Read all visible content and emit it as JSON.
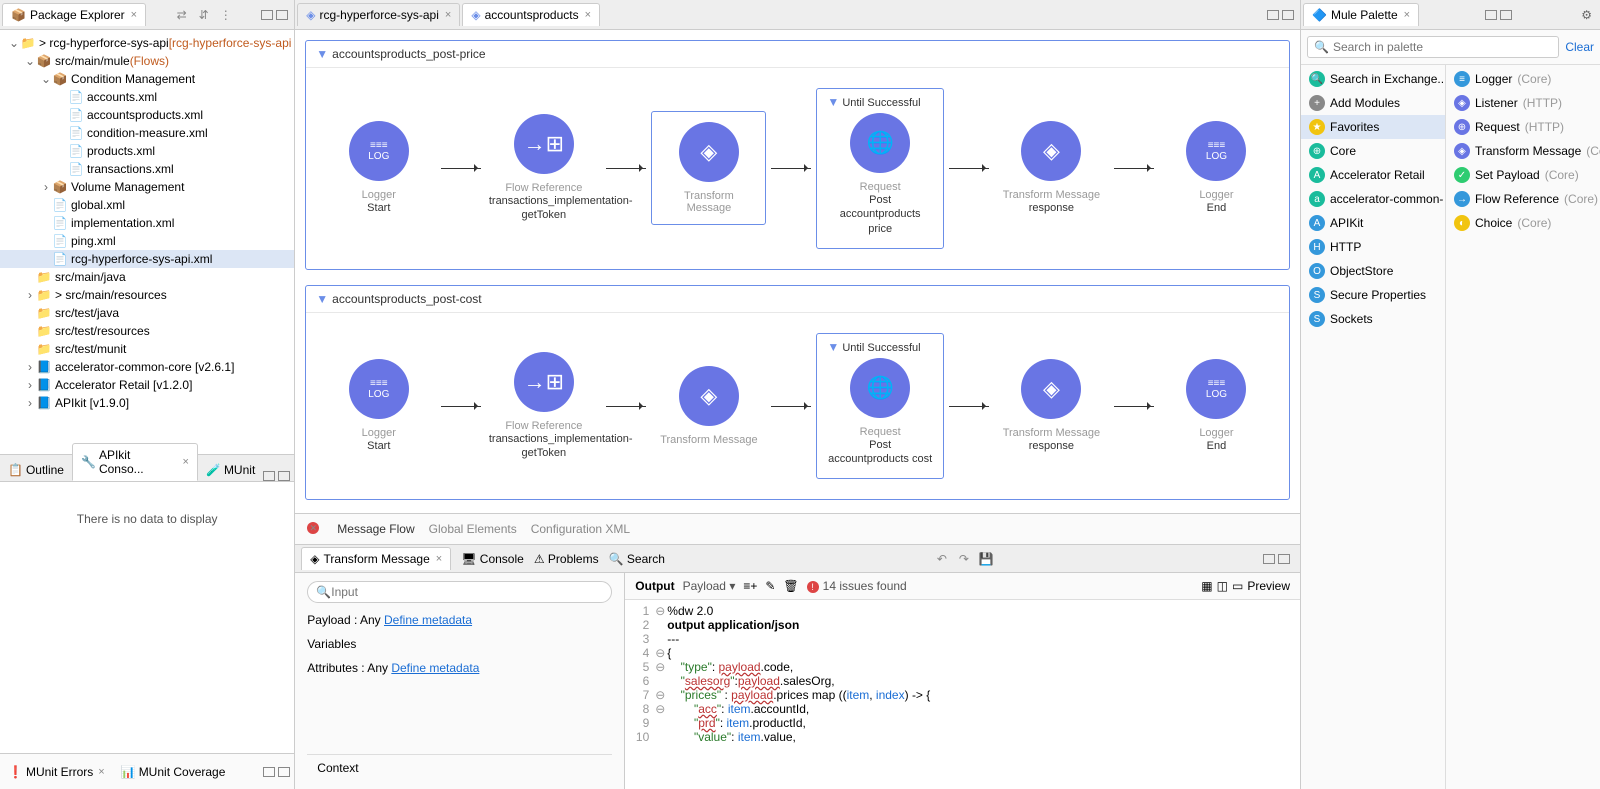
{
  "explorer": {
    "title": "Package Explorer",
    "tree": [
      {
        "depth": 0,
        "twisty": "v",
        "icon": "proj",
        "text": "> rcg-hyperforce-sys-api",
        "suffix": "[rcg-hyperforce-sys-api"
      },
      {
        "depth": 1,
        "twisty": "v",
        "icon": "pkg",
        "text": "src/main/mule",
        "suffix": "(Flows)",
        "sfxColor": "#c05b1f"
      },
      {
        "depth": 2,
        "twisty": "v",
        "icon": "pkg",
        "text": "Condition Management"
      },
      {
        "depth": 3,
        "twisty": "",
        "icon": "xml",
        "text": "accounts.xml"
      },
      {
        "depth": 3,
        "twisty": "",
        "icon": "xml",
        "text": "accountsproducts.xml"
      },
      {
        "depth": 3,
        "twisty": "",
        "icon": "xml",
        "text": "condition-measure.xml"
      },
      {
        "depth": 3,
        "twisty": "",
        "icon": "xml",
        "text": "products.xml"
      },
      {
        "depth": 3,
        "twisty": "",
        "icon": "xml",
        "text": "transactions.xml"
      },
      {
        "depth": 2,
        "twisty": ">",
        "icon": "pkg",
        "text": "Volume Management"
      },
      {
        "depth": 2,
        "twisty": "",
        "icon": "xml",
        "text": "global.xml"
      },
      {
        "depth": 2,
        "twisty": "",
        "icon": "xml",
        "text": "implementation.xml"
      },
      {
        "depth": 2,
        "twisty": "",
        "icon": "xml",
        "text": "ping.xml"
      },
      {
        "depth": 2,
        "twisty": "",
        "icon": "xml",
        "text": "rcg-hyperforce-sys-api.xml",
        "sel": true
      },
      {
        "depth": 1,
        "twisty": "",
        "icon": "folder",
        "text": "src/main/java"
      },
      {
        "depth": 1,
        "twisty": ">",
        "icon": "folder",
        "text": "> src/main/resources"
      },
      {
        "depth": 1,
        "twisty": "",
        "icon": "folder",
        "text": "src/test/java"
      },
      {
        "depth": 1,
        "twisty": "",
        "icon": "folder",
        "text": "src/test/resources"
      },
      {
        "depth": 1,
        "twisty": "",
        "icon": "folder",
        "text": "src/test/munit"
      },
      {
        "depth": 1,
        "twisty": ">",
        "icon": "jar",
        "text": "accelerator-common-core [v2.6.1]"
      },
      {
        "depth": 1,
        "twisty": ">",
        "icon": "jar",
        "text": "Accelerator Retail [v1.2.0]"
      },
      {
        "depth": 1,
        "twisty": ">",
        "icon": "jar",
        "text": "APIkit [v1.9.0]"
      }
    ]
  },
  "lowerLeft": {
    "tabs": [
      "Outline",
      "APIkit Conso...",
      "MUnit"
    ],
    "empty": "There is no data to display",
    "errTabs": [
      "MUnit Errors",
      "MUnit Coverage"
    ]
  },
  "editor": {
    "tabs": [
      {
        "label": "rcg-hyperforce-sys-api",
        "active": false
      },
      {
        "label": "accountsproducts",
        "active": true
      }
    ],
    "flows": [
      {
        "title": "accountsproducts_post-price",
        "until": "Until Successful",
        "req": "Request",
        "reqSub": "Post accountproducts price",
        "nodes": [
          {
            "type": "log",
            "label": "Logger",
            "sub": "Start"
          },
          {
            "type": "ref",
            "label": "Flow Reference",
            "sub": "transactions_implementation-getToken"
          },
          {
            "type": "tm",
            "label": "Transform Message",
            "sub": "",
            "selected": true
          },
          {
            "type": "until"
          },
          {
            "type": "tm",
            "label": "Transform Message",
            "sub": "response"
          },
          {
            "type": "log",
            "label": "Logger",
            "sub": "End"
          }
        ]
      },
      {
        "title": "accountsproducts_post-cost",
        "until": "Until Successful",
        "req": "Request",
        "reqSub": "Post accountproducts cost",
        "nodes": [
          {
            "type": "log",
            "label": "Logger",
            "sub": "Start"
          },
          {
            "type": "ref",
            "label": "Flow Reference",
            "sub": "transactions_implementation-getToken"
          },
          {
            "type": "tm",
            "label": "Transform Message",
            "sub": ""
          },
          {
            "type": "until"
          },
          {
            "type": "tm",
            "label": "Transform Message",
            "sub": "response"
          },
          {
            "type": "log",
            "label": "Logger",
            "sub": "End"
          }
        ]
      }
    ],
    "bottomTabs": [
      "Message Flow",
      "Global Elements",
      "Configuration XML"
    ]
  },
  "tm": {
    "tabs": [
      "Transform Message",
      "Console",
      "Problems",
      "Search"
    ],
    "inputPlaceholder": "Input",
    "payload": "Payload : Any ",
    "defineMeta": "Define metadata",
    "variables": "Variables",
    "attributes": "Attributes : Any ",
    "context": "Context",
    "output": "Output",
    "payloadDD": "Payload",
    "issues": "14 issues found",
    "preview": "Preview",
    "code": [
      {
        "n": "1",
        "fold": "⊖",
        "t": "%dw 2.0"
      },
      {
        "n": "2",
        "fold": "",
        "t": "output application/json",
        "bold": true
      },
      {
        "n": "3",
        "fold": "",
        "t": "---"
      },
      {
        "n": "4",
        "fold": "⊖",
        "t": "{"
      },
      {
        "n": "5",
        "fold": "⊖",
        "html": "    <span class='str'>\"type\"</span>: <span class='err'>payload</span>.code,"
      },
      {
        "n": "6",
        "fold": "",
        "html": "    <span class='str'>\"<span class='err'>salesorg</span>\"</span>:<span class='err'>payload</span>.salesOrg,"
      },
      {
        "n": "7",
        "fold": "⊖",
        "html": "    <span class='str'>\"prices\"</span> : <span class='err'>payload</span>.prices map ((<span class='prop'>item</span>, <span class='prop'>index</span>) -> {"
      },
      {
        "n": "8",
        "fold": "⊖",
        "html": "        <span class='str'>\"<span class='err'>acc</span>\"</span>: <span class='prop'>item</span>.accountId,"
      },
      {
        "n": "9",
        "fold": "",
        "html": "        <span class='str'>\"<span class='err'>prd</span>\"</span>: <span class='prop'>item</span>.productId,"
      },
      {
        "n": "10",
        "fold": "",
        "html": "        <span class='str'>\"value\"</span>: <span class='prop'>item</span>.value,"
      }
    ]
  },
  "palette": {
    "title": "Mule Palette",
    "searchPlaceholder": "Search in palette",
    "clear": "Clear",
    "left": [
      {
        "icon": "🔍",
        "text": "Search in Exchange..",
        "bg": "#1abc9c"
      },
      {
        "icon": "+",
        "text": "Add Modules",
        "bg": "#888"
      },
      {
        "icon": "★",
        "text": "Favorites",
        "bg": "#f1c40f",
        "sel": true
      },
      {
        "icon": "⊕",
        "text": "Core",
        "bg": "#1abc9c"
      },
      {
        "icon": "A",
        "text": "Accelerator Retail",
        "bg": "#1abc9c"
      },
      {
        "icon": "a",
        "text": "accelerator-common-",
        "bg": "#1abc9c"
      },
      {
        "icon": "A",
        "text": "APIKit",
        "bg": "#3498db"
      },
      {
        "icon": "H",
        "text": "HTTP",
        "bg": "#3498db"
      },
      {
        "icon": "O",
        "text": "ObjectStore",
        "bg": "#3498db"
      },
      {
        "icon": "S",
        "text": "Secure Properties",
        "bg": "#3498db"
      },
      {
        "icon": "S",
        "text": "Sockets",
        "bg": "#3498db"
      }
    ],
    "right": [
      {
        "icon": "≡",
        "text": "Logger",
        "sfx": "(Core)",
        "bg": "#3498db"
      },
      {
        "icon": "◈",
        "text": "Listener",
        "sfx": "(HTTP)",
        "bg": "#6975e4"
      },
      {
        "icon": "⊕",
        "text": "Request",
        "sfx": "(HTTP)",
        "bg": "#6975e4"
      },
      {
        "icon": "◈",
        "text": "Transform Message",
        "sfx": "(Co",
        "bg": "#6975e4"
      },
      {
        "icon": "✓",
        "text": "Set Payload",
        "sfx": "(Core)",
        "bg": "#2ecc71"
      },
      {
        "icon": "→",
        "text": "Flow Reference",
        "sfx": "(Core)",
        "bg": "#3498db"
      },
      {
        "icon": "◐",
        "text": "Choice",
        "sfx": "(Core)",
        "bg": "#f1c40f"
      }
    ]
  }
}
